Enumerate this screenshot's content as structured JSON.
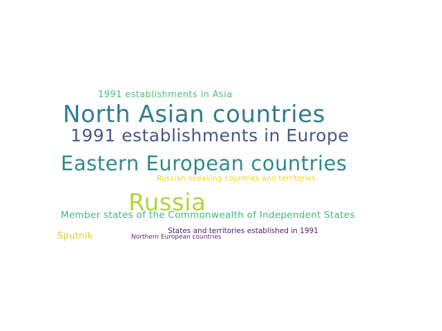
{
  "words": [
    {
      "id": "north-asian",
      "text": "North Asian countries",
      "color": "#2f7d8e"
    },
    {
      "id": "1991-europe",
      "text": "1991 establishments in Europe",
      "color": "#46588a"
    },
    {
      "id": "eastern-european",
      "text": "Eastern European countries",
      "color": "#2f8a8c"
    },
    {
      "id": "russia",
      "text": "Russia",
      "color": "#b4d43a"
    },
    {
      "id": "cis",
      "text": "Member states of the Commonwealth of Independent States",
      "color": "#3db878"
    },
    {
      "id": "1991-asia",
      "text": "1991 establishments in Asia",
      "color": "#52c072"
    },
    {
      "id": "russian-speaking",
      "text": "Russian-speaking countries and territories",
      "color": "#e8d820"
    },
    {
      "id": "states-1991",
      "text": "States and territories established in 1991",
      "color": "#4e1a6e"
    },
    {
      "id": "sputnik",
      "text": "Sputnik",
      "color": "#d6d428"
    },
    {
      "id": "northern-european",
      "text": "Northern European countries",
      "color": "#5a2a78"
    }
  ]
}
